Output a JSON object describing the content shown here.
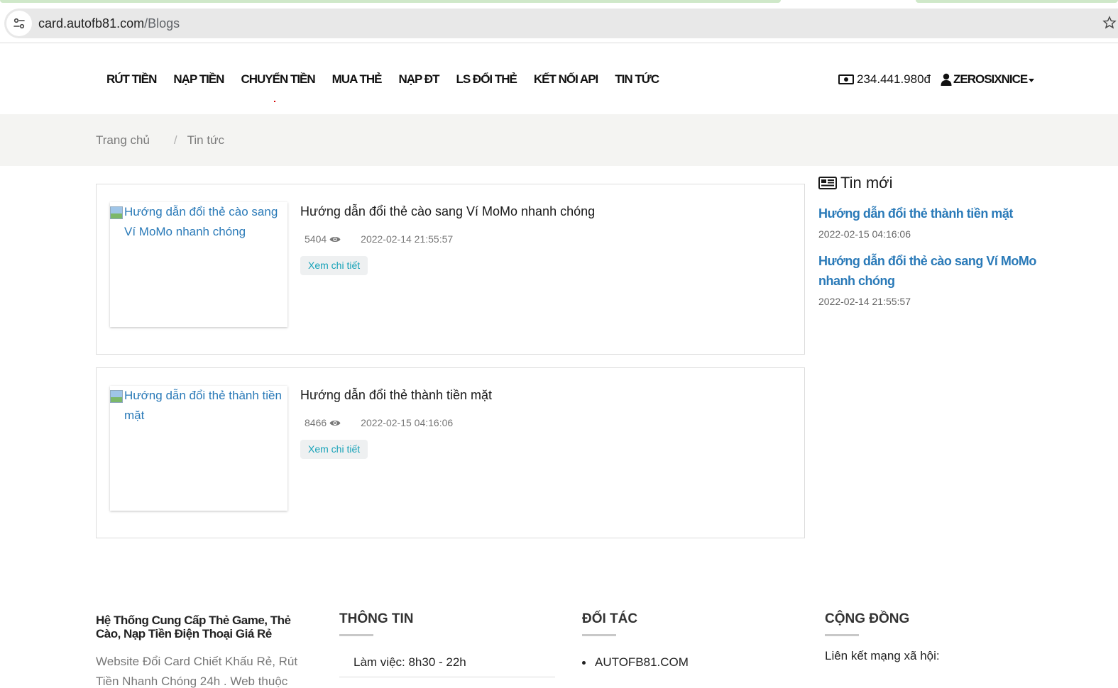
{
  "browser": {
    "url_host": "card.autofb81.com",
    "url_path": "/Blogs"
  },
  "nav": {
    "items": [
      {
        "label": "RÚT TIỀN"
      },
      {
        "label": "NẠP TIỀN"
      },
      {
        "label": "CHUYỂN TIỀN"
      },
      {
        "label": "MUA THẺ"
      },
      {
        "label": "NẠP ĐT"
      },
      {
        "label": "LS ĐỔI THẺ"
      },
      {
        "label": "KẾT NỐI API"
      },
      {
        "label": "TIN TỨC"
      }
    ],
    "balance": "234.441.980đ",
    "username": "ZEROSIXNICE"
  },
  "breadcrumb": {
    "home": "Trang chủ",
    "separator": "/",
    "current": "Tin tức"
  },
  "posts": [
    {
      "thumb_alt": "Hướng dẫn đổi thẻ cào sang Ví MoMo nhanh chóng",
      "title": "Hướng dẫn đổi thẻ cào sang Ví MoMo nhanh chóng",
      "views": "5404",
      "date": "2022-02-14 21:55:57",
      "button": "Xem chi tiết"
    },
    {
      "thumb_alt": "Hướng dẫn đổi thẻ thành tiền mặt",
      "title": "Hướng dẫn đổi thẻ thành tiền mặt",
      "views": "8466",
      "date": "2022-02-15 04:16:06",
      "button": "Xem chi tiết"
    }
  ],
  "sidebar": {
    "title": "Tin mới",
    "items": [
      {
        "title": "Hướng dẫn đổi thẻ thành tiền mặt",
        "date": "2022-02-15 04:16:06"
      },
      {
        "title": "Hướng dẫn đổi thẻ cào sang Ví MoMo nhanh chóng",
        "date": "2022-02-14 21:55:57"
      }
    ]
  },
  "footer": {
    "brand_title": "Hệ Thống Cung Cấp Thẻ Game, Thẻ Cào, Nạp Tiền Điện Thoại Giá Rẻ",
    "brand_desc": "Website Đổi Card Chiết Khấu Rẻ, Rút Tiền Nhanh Chóng 24h . Web thuộc",
    "info_heading": "THÔNG TIN",
    "info_item": "Làm việc: 8h30 - 22h",
    "partner_heading": "ĐỐI TÁC",
    "partner_item": "AUTOFB81.COM",
    "community_heading": "CỘNG ĐỒNG",
    "community_text": "Liên kết mạng xã hội:"
  }
}
